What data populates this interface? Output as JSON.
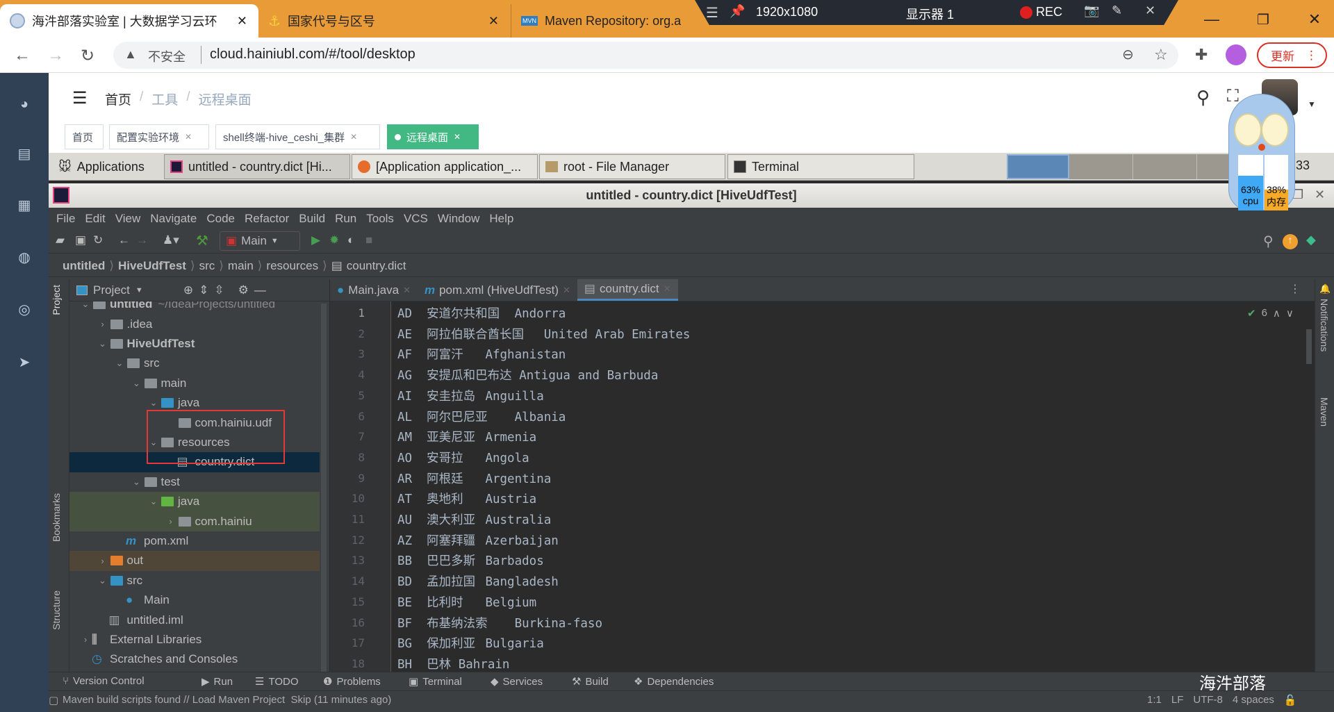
{
  "browser": {
    "tabs": [
      {
        "title": "海汼部落实验室 | 大数据学习云环",
        "active": true
      },
      {
        "title": "国家代号与区号",
        "active": false
      },
      {
        "title": "Maven Repository: org.a",
        "active": false
      }
    ],
    "security_label": "不安全",
    "url": "cloud.hainiubl.com/#/tool/desktop",
    "update_label": "更新"
  },
  "recorder": {
    "resolution": "1920x1080",
    "display": "显示器 1",
    "rec_label": "REC"
  },
  "app": {
    "breadcrumb": [
      "首页",
      "工具",
      "远程桌面"
    ],
    "tags": [
      {
        "label": "首页",
        "closable": false
      },
      {
        "label": "配置实验环境",
        "closable": true
      },
      {
        "label": "shell终端-hive_ceshi_集群",
        "closable": true
      },
      {
        "label": "远程桌面",
        "closable": true,
        "active": true
      }
    ],
    "active_color": "#42b983"
  },
  "panel": {
    "apps_label": "Applications",
    "windows": [
      "untitled - country.dict [Hi...",
      "[Application application_...",
      "root - File Manager",
      "Terminal"
    ],
    "clock": "19:33"
  },
  "monitor": {
    "cpu": "63%",
    "cpu_label": "cpu",
    "cpu_value": 63,
    "mem": "38%",
    "mem_label": "内存",
    "mem_value": 38
  },
  "ide": {
    "title": "untitled - country.dict [HiveUdfTest]",
    "menu": [
      "File",
      "Edit",
      "View",
      "Navigate",
      "Code",
      "Refactor",
      "Build",
      "Run",
      "Tools",
      "VCS",
      "Window",
      "Help"
    ],
    "run_config": "Main",
    "nav": [
      "untitled",
      "HiveUdfTest",
      "src",
      "main",
      "resources",
      "country.dict"
    ],
    "project_label": "Project",
    "left_tools": [
      "Project",
      "Bookmarks",
      "Structure"
    ],
    "right_tools": [
      "Notifications",
      "Maven"
    ],
    "tree": [
      {
        "label": "untitled",
        "hint": "~/IdeaProjects/untitled",
        "level": 0,
        "chev": "down",
        "icon": "module",
        "bold": true
      },
      {
        "label": ".idea",
        "level": 1,
        "chev": "right",
        "icon": "folder"
      },
      {
        "label": "HiveUdfTest",
        "level": 1,
        "chev": "down",
        "icon": "module",
        "bold": true
      },
      {
        "label": "src",
        "level": 2,
        "chev": "down",
        "icon": "folder"
      },
      {
        "label": "main",
        "level": 3,
        "chev": "down",
        "icon": "folder"
      },
      {
        "label": "java",
        "level": 4,
        "chev": "down",
        "icon": "source"
      },
      {
        "label": "com.hainiu.udf",
        "level": 5,
        "chev": "",
        "icon": "package"
      },
      {
        "label": "resources",
        "level": 4,
        "chev": "down",
        "icon": "resources"
      },
      {
        "label": "country.dict",
        "level": 5,
        "chev": "",
        "icon": "file",
        "selected": true
      },
      {
        "label": "test",
        "level": 3,
        "chev": "down",
        "icon": "folder"
      },
      {
        "label": "java",
        "level": 4,
        "chev": "down",
        "icon": "test",
        "bg": "test"
      },
      {
        "label": "com.hainiu",
        "level": 5,
        "chev": "right",
        "icon": "package",
        "bg": "test"
      },
      {
        "label": "pom.xml",
        "level": 2,
        "chev": "",
        "icon": "maven"
      },
      {
        "label": "out",
        "level": 1,
        "chev": "right",
        "icon": "excluded",
        "bg": "out"
      },
      {
        "label": "src",
        "level": 1,
        "chev": "down",
        "icon": "source"
      },
      {
        "label": "Main",
        "level": 2,
        "chev": "",
        "icon": "class"
      },
      {
        "label": "untitled.iml",
        "level": 1,
        "chev": "",
        "icon": "iml"
      },
      {
        "label": "External Libraries",
        "level": 0,
        "chev": "right",
        "icon": "libs"
      },
      {
        "label": "Scratches and Consoles",
        "level": 0,
        "chev": "",
        "icon": "scratch"
      }
    ],
    "editor_tabs": [
      {
        "label": "Main.java",
        "icon": "class"
      },
      {
        "label": "pom.xml (HiveUdfTest)",
        "icon": "maven"
      },
      {
        "label": "country.dict",
        "icon": "file",
        "active": true
      }
    ],
    "inspection_count": "6",
    "lines": [
      "AD\t安道尔共和国\tAndorra",
      "AE\t阿拉伯联合酋长国\tUnited Arab Emirates",
      "AF\t阿富汗\tAfghanistan",
      "AG\t安提瓜和巴布达 Antigua and Barbuda",
      "AI\t安圭拉岛\tAnguilla",
      "AL\t阿尔巴尼亚\tAlbania",
      "AM\t亚美尼亚\tArmenia",
      "AO\t安哥拉\tAngola",
      "AR\t阿根廷\tArgentina",
      "AT\t奥地利\tAustria",
      "AU\t澳大利亚\tAustralia",
      "AZ\t阿塞拜疆\tAzerbaijan",
      "BB\t巴巴多斯\tBarbados",
      "BD\t孟加拉国\tBangladesh",
      "BE\t比利时\tBelgium",
      "BF\t布基纳法索\tBurkina-faso",
      "BG\t保加利亚\tBulgaria",
      "BH\t巴林 Bahrain"
    ],
    "bottom_tools": [
      "Version Control",
      "Run",
      "TODO",
      "Problems",
      "Terminal",
      "Services",
      "Build",
      "Dependencies"
    ],
    "watermark": "海汼部落",
    "status_message": "Maven build scripts found // Load Maven Project  Skip (11 minutes ago)",
    "status_right": [
      "1:1",
      "LF",
      "UTF-8",
      "4 spaces"
    ]
  }
}
